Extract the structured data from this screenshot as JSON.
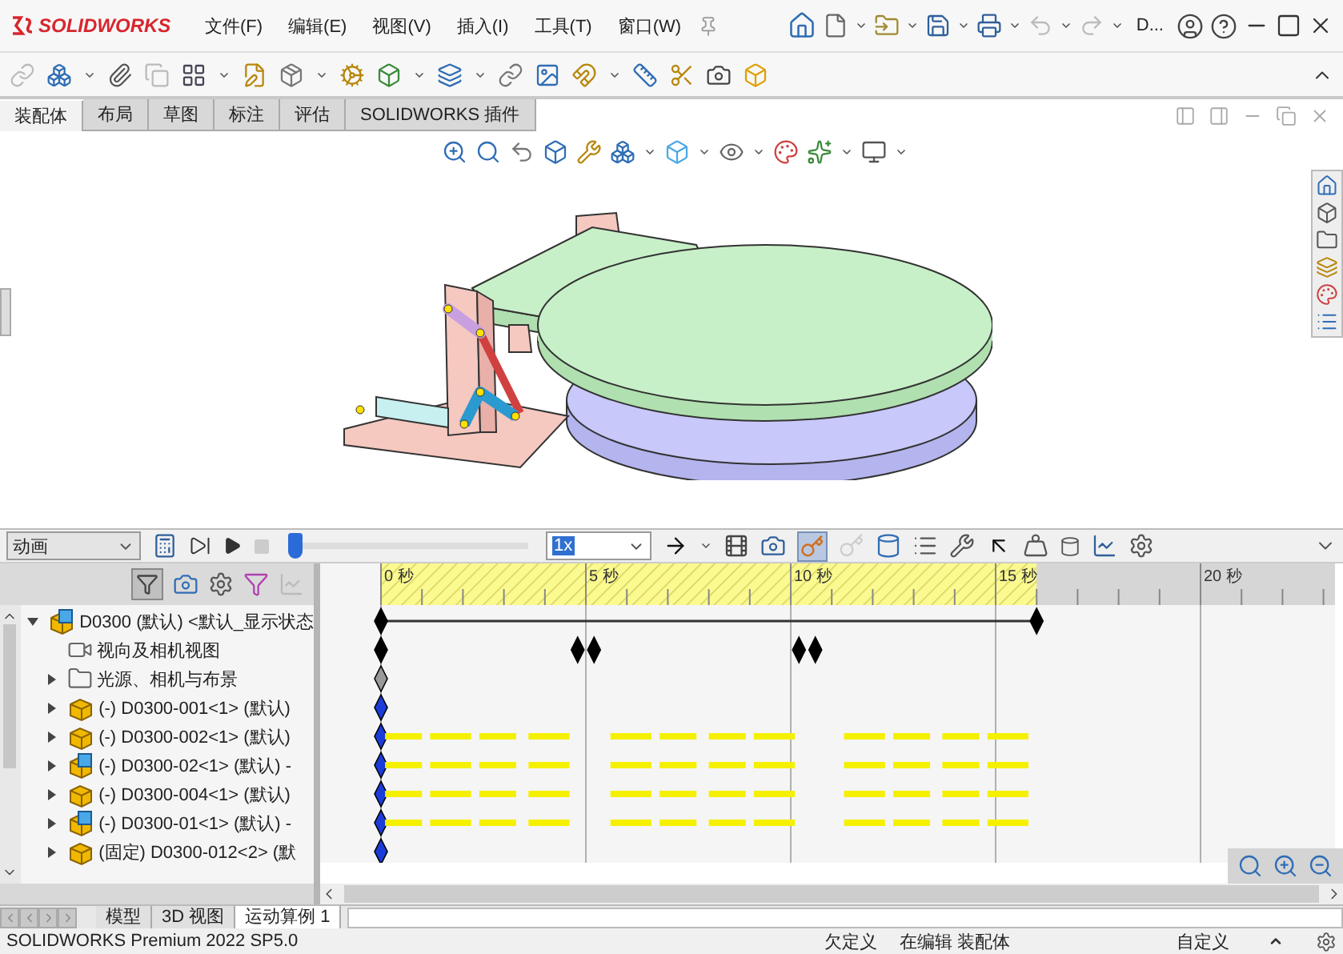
{
  "app": {
    "logo": "SOLIDWORKS",
    "document": "D..."
  },
  "menu": [
    "文件(F)",
    "编辑(E)",
    "视图(V)",
    "插入(I)",
    "工具(T)",
    "窗口(W)"
  ],
  "ribbon_tabs": [
    {
      "label": "装配体",
      "selected": true
    },
    {
      "label": "布局",
      "selected": false
    },
    {
      "label": "草图",
      "selected": false
    },
    {
      "label": "标注",
      "selected": false
    },
    {
      "label": "评估",
      "selected": false
    },
    {
      "label": "SOLIDWORKS 插件",
      "selected": false
    }
  ],
  "motion_toolbar": {
    "study_type": "动画",
    "level": 0,
    "speed": "1x",
    "autokey_on": true
  },
  "timeline": {
    "ruler": [
      "0 秒",
      "5 秒",
      "10 秒",
      "15 秒",
      "20 秒"
    ]
  },
  "tree": [
    {
      "kind": "assembly",
      "label": "D0300 (默认) <默认_显示状态",
      "expanded": true,
      "track": {
        "kind": "summary"
      }
    },
    {
      "kind": "camera",
      "label": "视向及相机视图",
      "track": {
        "kind": "camera"
      }
    },
    {
      "kind": "lights",
      "label": "光源、相机与布景",
      "expanded": false,
      "track": {
        "kind": "gray-key"
      }
    },
    {
      "kind": "part",
      "label": "(-) D0300-001<1> (默认)",
      "expanded": false,
      "track": {
        "kind": "key"
      }
    },
    {
      "kind": "part",
      "label": "(-) D0300-002<1> (默认)",
      "expanded": false,
      "track": {
        "kind": "dashed"
      }
    },
    {
      "kind": "assembly",
      "label": "(-) D0300-02<1> (默认) -",
      "expanded": false,
      "track": {
        "kind": "dashed"
      }
    },
    {
      "kind": "part",
      "label": "(-) D0300-004<1> (默认)",
      "expanded": false,
      "track": {
        "kind": "dashed"
      }
    },
    {
      "kind": "assembly",
      "label": "(-) D0300-01<1> (默认) -",
      "expanded": false,
      "track": {
        "kind": "dashed"
      }
    },
    {
      "kind": "part",
      "label": "(固定) D0300-012<2> (默",
      "expanded": false,
      "track": {
        "kind": "key"
      }
    }
  ],
  "bottom_tabs": [
    {
      "label": "模型",
      "selected": false
    },
    {
      "label": "3D 视图",
      "selected": false
    },
    {
      "label": "运动算例 1",
      "selected": true
    }
  ],
  "status_bar": {
    "product": "SOLIDWORKS Premium 2022 SP5.0",
    "definition": "欠定义",
    "mode": "在编辑 装配体",
    "units": "自定义"
  }
}
